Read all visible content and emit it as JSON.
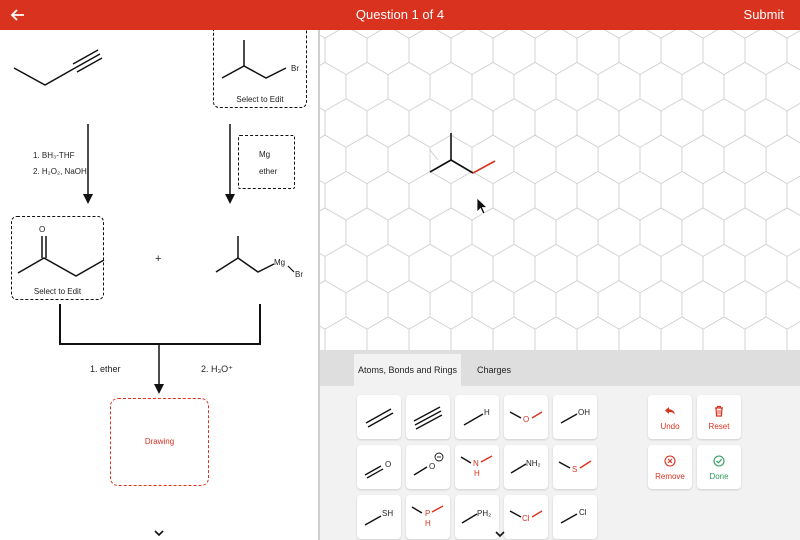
{
  "header": {
    "title": "Question 1 of 4",
    "submit_label": "Submit"
  },
  "scheme": {
    "reagents_left": [
      "1. BH₃-THF",
      "2. H₂O₂, NaOH"
    ],
    "reagents_right": [
      "Mg",
      "ether"
    ],
    "select_to_edit": "Select to Edit",
    "plus": "+",
    "ketone_o": "O",
    "br_label": "Br",
    "grignard_mg": "Mg",
    "grignard_br": "Br",
    "step1": "1. ether",
    "step2": "2. H₃O⁺",
    "drawing_label": "Drawing"
  },
  "panel": {
    "tabs": [
      "Atoms, Bonds and Rings",
      "Charges"
    ],
    "active_tab": "Atoms, Bonds and Rings",
    "tool_labels": {
      "h": "H",
      "o": "O",
      "oh": "OH",
      "o_neg": "O",
      "nh": "N",
      "nh_h": "H",
      "nh2": "NH₂",
      "s": "S",
      "sh": "SH",
      "ph": "P",
      "ph_h": "H",
      "ph2": "PH₂",
      "cl_red": "Cl",
      "cl": "Cl"
    },
    "actions": {
      "undo": "Undo",
      "reset": "Reset",
      "remove": "Remove",
      "done": "Done"
    }
  },
  "colors": {
    "brand": "#d9331f",
    "done": "#2e9d5b"
  }
}
